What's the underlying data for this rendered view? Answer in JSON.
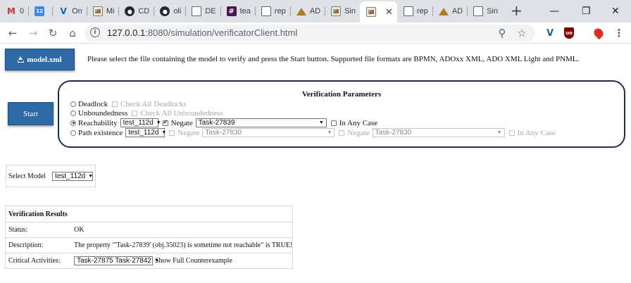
{
  "browser": {
    "tabs": [
      {
        "label": "0",
        "icon": "gmail-icon"
      },
      {
        "label": "12",
        "icon": "calendar-icon"
      },
      {
        "label": "On",
        "icon": "v-logo-icon"
      },
      {
        "label": "Mi",
        "icon": "image-icon"
      },
      {
        "label": "CD",
        "icon": "github-icon"
      },
      {
        "label": "oli",
        "icon": "github-icon"
      },
      {
        "label": "DE",
        "icon": "document-icon"
      },
      {
        "label": "tea",
        "icon": "slack-icon"
      },
      {
        "label": "rep",
        "icon": "document-icon"
      },
      {
        "label": "AD",
        "icon": "adonis-icon"
      },
      {
        "label": "Sin",
        "icon": "image-icon"
      },
      {
        "label": "",
        "icon": "image-icon",
        "active": true
      },
      {
        "label": "rep",
        "icon": "document-icon"
      },
      {
        "label": "AD",
        "icon": "adonis-icon"
      },
      {
        "label": "Sin",
        "icon": "document-icon"
      }
    ],
    "url_host": "127.0.0.1",
    "url_rest": ":8080/simulation/verificatorClient.html"
  },
  "page": {
    "model_button": "model.xml",
    "intro": "Please select the file containing the model to verify and press the Start button. Supported file formats are BPMN, ADOxx XML, ADO XML Light and PNML.",
    "start_button": "Start",
    "params": {
      "title": "Verification Parameters",
      "deadlock": {
        "label": "Deadlock",
        "check_all": "Check All Deadlocks"
      },
      "unboundedness": {
        "label": "Unboundedness",
        "check_all": "Check All Unboundedness"
      },
      "reachability": {
        "label": "Reachability",
        "model": "test_112d",
        "negate": "Negate",
        "task": "Task-27839",
        "any_case": "In Any Case"
      },
      "path": {
        "label": "Path existence",
        "model": "test_112d",
        "negate1": "Negate",
        "task1": "Task-27830",
        "negate2": "Negate",
        "task2": "Task-27830",
        "any_case": "In Any Case"
      }
    },
    "select_model": {
      "label": "Select Model",
      "value": "test_112d"
    },
    "results": {
      "title": "Verification Results",
      "status_key": "Status:",
      "status_val": "OK",
      "desc_key": "Description:",
      "desc_val": "The property \"'Task-27839' (obj.35023) is sometime not reachable\" is TRUE!",
      "crit_key": "Critical Activities:",
      "crit_val": "Task-27875 Task-27842",
      "show_full": "Show Full Counterexample"
    }
  }
}
